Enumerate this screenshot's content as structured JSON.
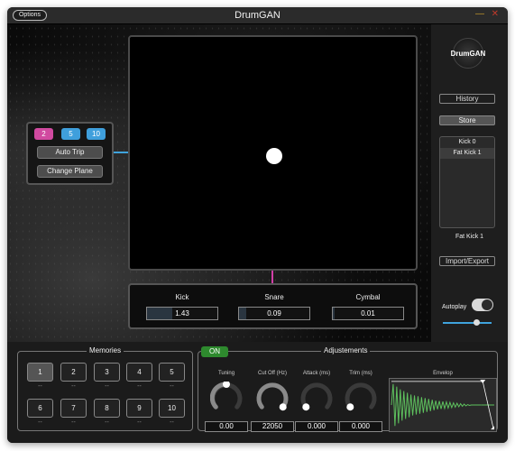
{
  "window": {
    "title": "DrumGAN",
    "options_label": "Options"
  },
  "sampler": {
    "chips": [
      "2",
      "5",
      "10"
    ],
    "auto_trip_label": "Auto Trip",
    "change_plane_label": "Change Plane"
  },
  "params": [
    {
      "label": "Kick",
      "value": "1.43",
      "level": 0.36
    },
    {
      "label": "Snare",
      "value": "0.09",
      "level": 0.1
    },
    {
      "label": "Cymbal",
      "value": "0.01",
      "level": 0.03
    }
  ],
  "sidebar": {
    "logo_text": "DrumGAN",
    "history_label": "History",
    "store_label": "Store",
    "presets": [
      "Kick 0",
      "Fat Kick 1"
    ],
    "selected_preset": "Fat Kick 1",
    "import_export_label": "Import/Export",
    "autoplay_label": "Autoplay",
    "autoplay_on": true
  },
  "memories": {
    "title": "Memories",
    "slots": [
      {
        "label": "1",
        "sub": "--"
      },
      {
        "label": "2",
        "sub": "--"
      },
      {
        "label": "3",
        "sub": "--"
      },
      {
        "label": "4",
        "sub": "--"
      },
      {
        "label": "5",
        "sub": "--"
      },
      {
        "label": "6",
        "sub": "--"
      },
      {
        "label": "7",
        "sub": "--"
      },
      {
        "label": "8",
        "sub": "--"
      },
      {
        "label": "9",
        "sub": "--"
      },
      {
        "label": "10",
        "sub": "--"
      }
    ]
  },
  "adjustments": {
    "title": "Adjustements",
    "on_label": "ON",
    "knobs": [
      {
        "label": "Tuning",
        "value": "0.00"
      },
      {
        "label": "Cut Off (Hz)",
        "value": "22050"
      },
      {
        "label": "Attack (ms)",
        "value": "0.000"
      },
      {
        "label": "Trim (ms)",
        "value": "0.000"
      }
    ],
    "envelop_label": "Envelop"
  },
  "colors": {
    "accent_blue": "#3fa3dc",
    "accent_pink": "#d14aa0",
    "on_green": "#2e8a2e",
    "wave_green": "#5ec25e"
  }
}
